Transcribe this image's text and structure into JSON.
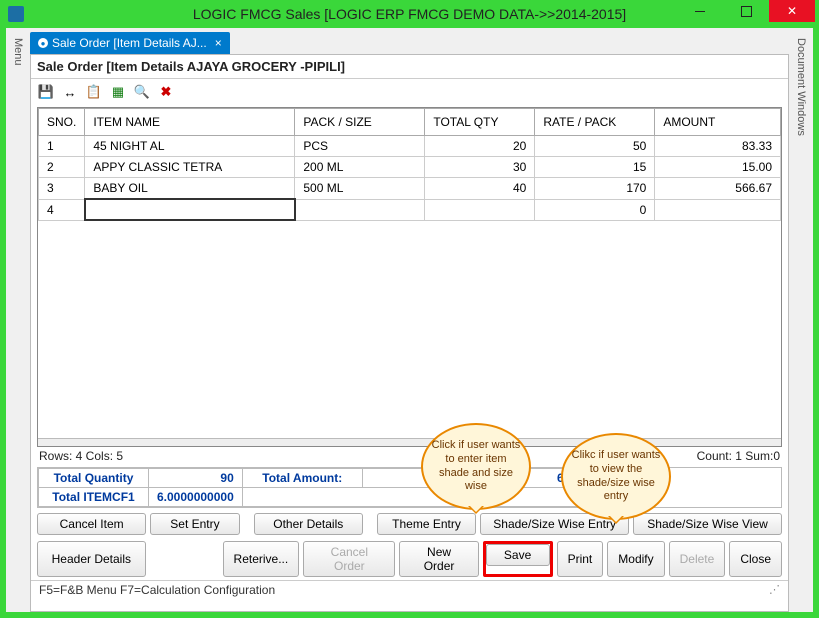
{
  "window": {
    "title": "LOGIC FMCG Sales  [LOGIC ERP FMCG DEMO DATA->>2014-2015]"
  },
  "side_tabs": {
    "left": "Menu",
    "right": "Document Windows"
  },
  "mdi_tab": {
    "label": "Sale Order [Item Details AJ..."
  },
  "header": {
    "text": "Sale Order [Item Details AJAYA GROCERY                             -PIPILI]"
  },
  "toolbar_icons": {
    "save": "save-icon",
    "fit": "fit-width-icon",
    "copy": "copy-icon",
    "excel": "excel-icon",
    "find": "search-icon",
    "delete": "delete-icon"
  },
  "grid": {
    "columns": [
      "SNO.",
      "ITEM NAME",
      "PACK / SIZE",
      "TOTAL QTY",
      "RATE / PACK",
      "AMOUNT"
    ],
    "rows": [
      {
        "sno": "1",
        "name": "45 NIGHT AL",
        "pack": "PCS",
        "qty": "20",
        "rate": "50",
        "amount": "83.33"
      },
      {
        "sno": "2",
        "name": "APPY CLASSIC TETRA",
        "pack": "200 ML",
        "qty": "30",
        "rate": "15",
        "amount": "15.00"
      },
      {
        "sno": "3",
        "name": "BABY OIL",
        "pack": "500 ML",
        "qty": "40",
        "rate": "170",
        "amount": "566.67"
      },
      {
        "sno": "4",
        "name": "",
        "pack": "",
        "qty": "",
        "rate": "0",
        "amount": ""
      }
    ]
  },
  "counter": {
    "left": "Rows: 4  Cols: 5",
    "right": "Count: 1  Sum:0"
  },
  "totals": {
    "tq_label": "Total Quantity",
    "tq_value": "90",
    "ta_label": "Total Amount:",
    "ta_value_left": "665.00",
    "ta_value_right": "665.00",
    "cf_label": "Total ITEMCF1",
    "cf_value": "6.0000000000"
  },
  "button_rows": {
    "row1": [
      "Cancel Item",
      "Set Entry",
      "Other Details",
      "Theme Entry",
      "Shade/Size Wise Entry",
      "Shade/Size Wise View"
    ],
    "row2": [
      "Header Details",
      "Reterive...",
      "Cancel Order",
      "New Order",
      "Save",
      "Print",
      "Modify",
      "Delete",
      "Close"
    ]
  },
  "status": {
    "text": "F5=F&B Menu  F7=Calculation Configuration"
  },
  "callouts": {
    "entry": "Click if user wants to enter item shade and size wise",
    "view": "Clikc if user wants to view the shade/size wise entry"
  }
}
